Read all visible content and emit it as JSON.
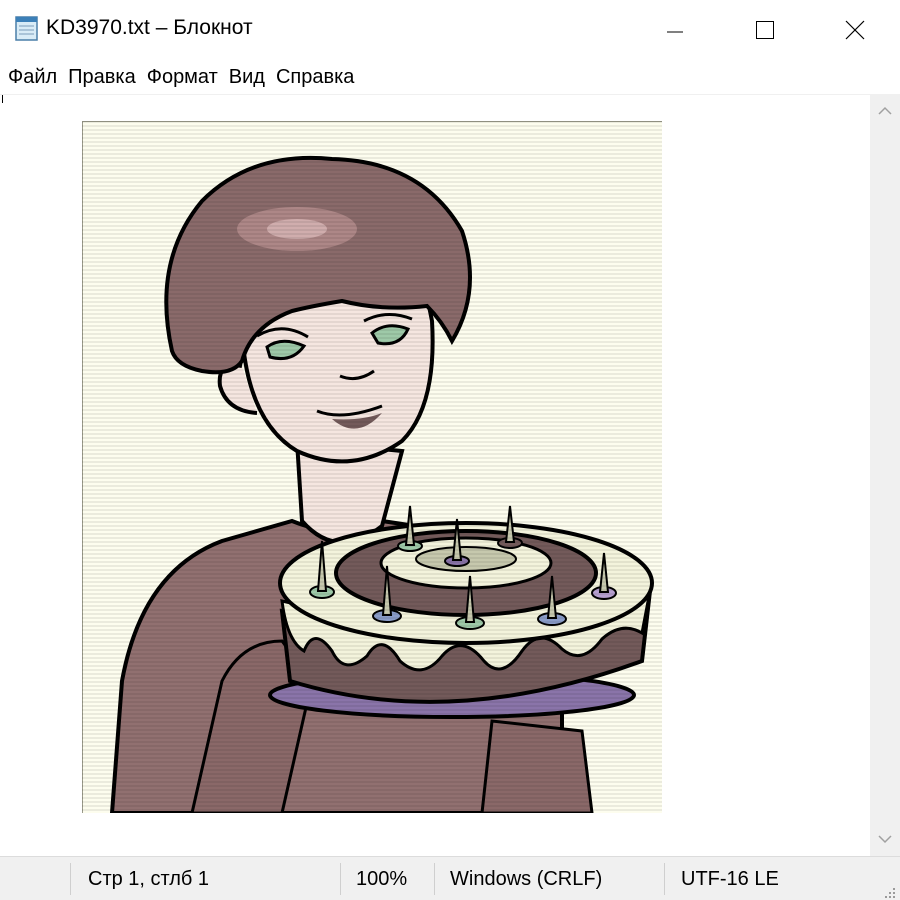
{
  "window": {
    "title": "KD3970.txt – Блокнот",
    "icons": {
      "app": "notepad-icon",
      "minimize": "minimize-icon",
      "maximize": "maximize-icon",
      "close": "close-icon"
    }
  },
  "menu": {
    "items": [
      "Файл",
      "Правка",
      "Формат",
      "Вид",
      "Справка"
    ]
  },
  "editor": {
    "image": "clipart-woman-holding-birthday-cake"
  },
  "scrollbar": {
    "up_icon": "chevron-up-icon",
    "down_icon": "chevron-down-icon"
  },
  "status": {
    "position": "Стр 1, стлб 1",
    "zoom": "100%",
    "line_endings": "Windows (CRLF)",
    "encoding": "UTF-16 LE"
  },
  "colors": {
    "background": "#ffffff",
    "statusbar": "#f0f0f0",
    "picture_background": "#fdfdee",
    "hair": "#8a6a6a",
    "skin": "#f5e6e0",
    "clothing": "#917070",
    "cake_icing": "#f3f3dc",
    "cake_chocolate": "#735a5a",
    "plate": "#8a74a9"
  }
}
